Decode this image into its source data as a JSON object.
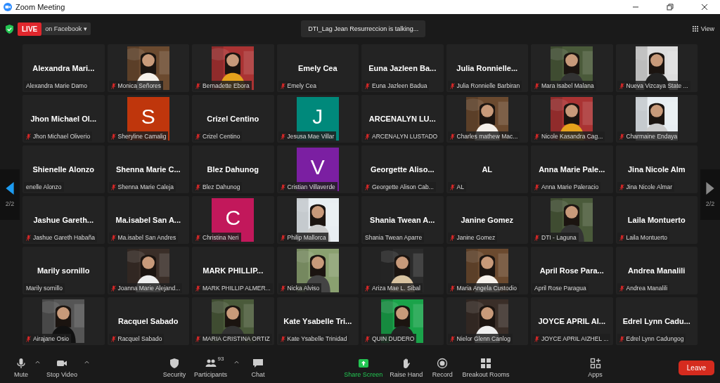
{
  "window": {
    "title": "Zoom Meeting"
  },
  "header": {
    "live": "LIVE",
    "stream": "on Facebook",
    "stream_caret": "▾",
    "speaker": "DTI_Lag Jean Resurreccion is talking...",
    "view": "View"
  },
  "nav": {
    "left": {
      "label": "2/2",
      "enabled": true
    },
    "right": {
      "label": "2/2",
      "enabled": false
    }
  },
  "tiles": [
    {
      "kind": "name",
      "display": "Alexandra  Mari...",
      "label": "Alexandra Marie Damo",
      "muted": false
    },
    {
      "kind": "picture",
      "label": "Monica Señores",
      "muted": true
    },
    {
      "kind": "picture",
      "label": "Bernadette Ebora",
      "muted": true
    },
    {
      "kind": "name",
      "display": "Emely Cea",
      "label": "Emely Cea",
      "muted": true
    },
    {
      "kind": "name",
      "display": "Euna  Jazleen  Ba...",
      "label": "Euna Jazleen Badua",
      "muted": true
    },
    {
      "kind": "name",
      "display": "Julia  Ronnielle...",
      "label": "Julia Ronnielle Barbiran",
      "muted": true
    },
    {
      "kind": "picture",
      "label": "Mara Isabel Malana",
      "muted": true
    },
    {
      "kind": "picture",
      "label": "Nueva Vizcaya State ...",
      "muted": true
    },
    {
      "kind": "name",
      "display": "Jhon  Michael  Ol...",
      "label": "Jhon Michael Oliverio",
      "muted": true
    },
    {
      "kind": "avatar",
      "display": "S",
      "color": "#bf360c",
      "label": "Sheryline Camalig",
      "muted": true
    },
    {
      "kind": "name",
      "display": "Crizel Centino",
      "label": "Crizel Centino",
      "muted": true
    },
    {
      "kind": "avatar",
      "display": "J",
      "color": "#00897b",
      "label": "Jesusa Mae Villar",
      "muted": true
    },
    {
      "kind": "name",
      "display": "ARCENALYN  LU...",
      "label": "ARCENALYN LUSTADO",
      "muted": true
    },
    {
      "kind": "picture",
      "label": "Charles mathew Mac...",
      "muted": true
    },
    {
      "kind": "picture",
      "label": "Nicole Kasandra Cag...",
      "muted": true
    },
    {
      "kind": "picture",
      "label": "Charmaine Endaya",
      "muted": true
    },
    {
      "kind": "name",
      "display": "Shienelle Alonzo",
      "label": "enelle Alonzo",
      "muted": false
    },
    {
      "kind": "name",
      "display": "Shenna  Marie  C...",
      "label": "Shenna Marie Caleja",
      "muted": true
    },
    {
      "kind": "name",
      "display": "Blez Dahunog",
      "label": "Blez Dahunog",
      "muted": true
    },
    {
      "kind": "avatar",
      "display": "V",
      "color": "#7b1fa2",
      "label": "Cristian Villaverde",
      "muted": true
    },
    {
      "kind": "name",
      "display": "Georgette  Aliso...",
      "label": "Georgette Alison Cab...",
      "muted": true
    },
    {
      "kind": "name",
      "display": "AL",
      "label": "AL",
      "muted": true
    },
    {
      "kind": "name",
      "display": "Anna  Marie  Pale...",
      "label": "Anna Marie Paleracio",
      "muted": true
    },
    {
      "kind": "name",
      "display": "Jina Nicole Alm",
      "label": "Jina Nicole Almar",
      "muted": true
    },
    {
      "kind": "name",
      "display": "Jashue   Gareth...",
      "label": "Jashue  Gareth Habaña",
      "muted": true
    },
    {
      "kind": "name",
      "display": "Ma.isabel  San  A...",
      "label": "Ma.isabel San Andres",
      "muted": true
    },
    {
      "kind": "avatar",
      "display": "C",
      "color": "#c2185b",
      "label": "Christina Neri",
      "muted": true
    },
    {
      "kind": "picture",
      "label": "Philip Mallorca",
      "muted": true
    },
    {
      "kind": "name",
      "display": "Shania  Twean  A...",
      "label": "Shania Twean Aparre",
      "muted": false
    },
    {
      "kind": "name",
      "display": "Janine Gomez",
      "label": "Janine Gomez",
      "muted": true
    },
    {
      "kind": "picture",
      "label": "DTI - Laguna",
      "muted": true
    },
    {
      "kind": "name",
      "display": "Laila Montuerto",
      "label": "Laila Montuerto",
      "muted": true
    },
    {
      "kind": "name",
      "display": "Marily sornillo",
      "label": "Marily sornillo",
      "muted": false
    },
    {
      "kind": "picture",
      "label": "Joanna Marie Alejand...",
      "muted": true
    },
    {
      "kind": "name",
      "display": "MARK  PHILLIP...",
      "label": "MARK PHILLIP ALMER...",
      "muted": true
    },
    {
      "kind": "picture",
      "label": "Nicka Alviso",
      "muted": true
    },
    {
      "kind": "picture",
      "label": "Ariza Mae L. Sibal",
      "muted": true
    },
    {
      "kind": "picture",
      "label": "Maria Angela Custodio",
      "muted": true
    },
    {
      "kind": "name",
      "display": "April  Rose  Para...",
      "label": "April Rose Paragua",
      "muted": false
    },
    {
      "kind": "name",
      "display": "Andrea Manalili",
      "label": "Andrea Manalili",
      "muted": true
    },
    {
      "kind": "picture",
      "label": "Airajane Osio",
      "muted": true
    },
    {
      "kind": "name",
      "display": "Racquel Sabado",
      "label": "Racquel Sabado",
      "muted": true
    },
    {
      "kind": "picture",
      "label": "MARIA CRISTINA ORTIZ",
      "muted": true
    },
    {
      "kind": "name",
      "display": "Kate  Ysabelle  Tri...",
      "label": "Kate Ysabelle Trinidad",
      "muted": true
    },
    {
      "kind": "picture",
      "label": "QUIN DUDERO",
      "muted": true
    },
    {
      "kind": "picture",
      "label": "Nielor Glenn Canlog",
      "muted": true
    },
    {
      "kind": "name",
      "display": "JOYCE  APRIL  AI...",
      "label": "JOYCE APRIL AIZHEL ...",
      "muted": true
    },
    {
      "kind": "name",
      "display": "Edrel  Lynn  Cadu...",
      "label": "Edrel Lynn Cadungog",
      "muted": true
    }
  ],
  "toolbar": [
    {
      "kind": "mic",
      "label": "Mute",
      "menu": true
    },
    {
      "kind": "video",
      "label": "Stop Video",
      "menu": true
    },
    {
      "kind": "shield",
      "label": "Security",
      "menu": false
    },
    {
      "kind": "people",
      "label": "Participants",
      "count": "93",
      "menu": true
    },
    {
      "kind": "chat",
      "label": "Chat",
      "menu": false
    },
    {
      "kind": "share",
      "label": "Share Screen",
      "menu": false
    },
    {
      "kind": "hand",
      "label": "Raise Hand",
      "menu": false
    },
    {
      "kind": "record",
      "label": "Record",
      "menu": false
    },
    {
      "kind": "rooms",
      "label": "Breakout Rooms",
      "menu": false
    },
    {
      "kind": "apps",
      "label": "Apps",
      "menu": false
    }
  ],
  "leave": "Leave"
}
